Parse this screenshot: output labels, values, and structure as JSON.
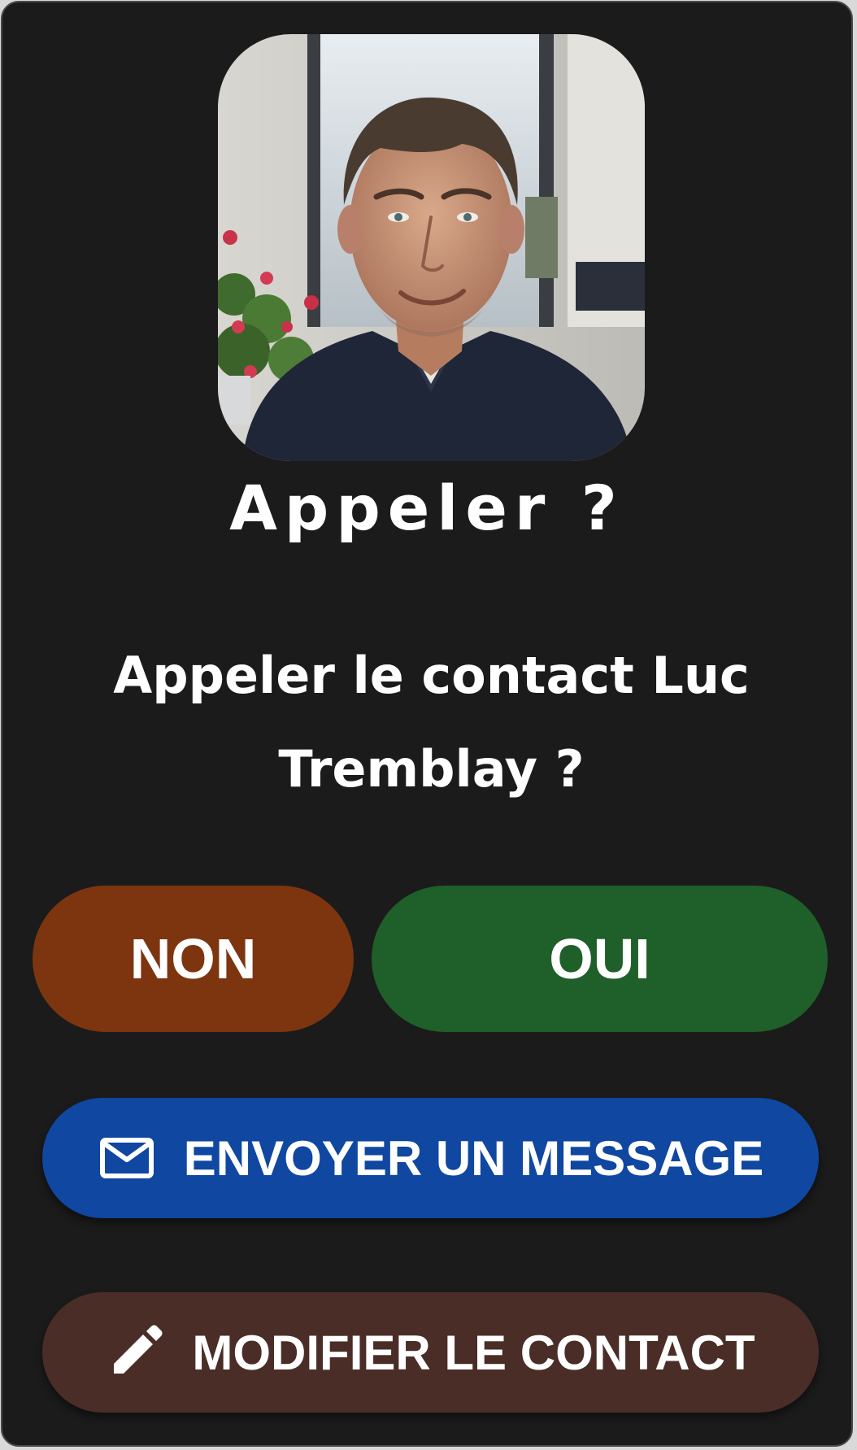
{
  "dialog": {
    "title": "Appeler ?",
    "message": "Appeler le contact Luc Tremblay ?",
    "avatar_alt": "Luc Tremblay"
  },
  "buttons": {
    "no_label": "NON",
    "yes_label": "OUI",
    "message_label": "ENVOYER UN MESSAGE",
    "message_icon": "mail-icon",
    "edit_label": "MODIFIER LE CONTACT",
    "edit_icon": "pencil-icon"
  },
  "colors": {
    "background": "#1b1b1b",
    "no": "#7d3510",
    "yes": "#1f5f29",
    "message": "#0f47a1",
    "edit": "#4a2d27"
  }
}
